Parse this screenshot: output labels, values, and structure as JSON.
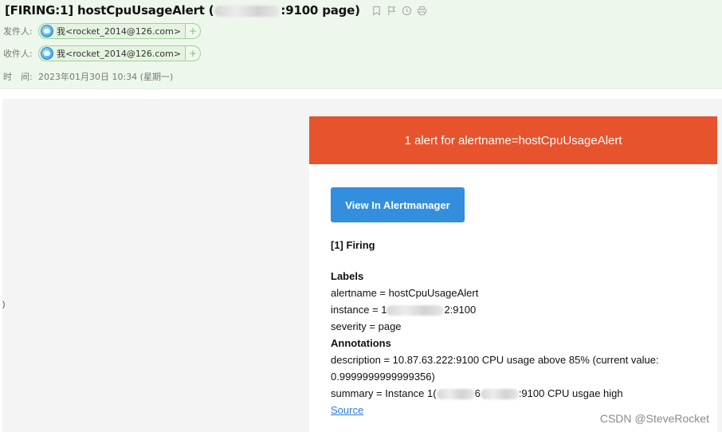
{
  "mail": {
    "subject_prefix": "[FIRING:1] hostCpuUsageAlert (",
    "subject_suffix": ":9100 page)",
    "action_icons": [
      "bookmark-icon",
      "flag-icon",
      "clock-icon",
      "print-icon"
    ],
    "from_label": "发件人:",
    "to_label": "收件人:",
    "time_label": "时　间:",
    "from_contact": "我<rocket_2014@126.com>",
    "to_contact": "我<rocket_2014@126.com>",
    "add_symbol": "+",
    "time_value": "2023年01月30日 10:34 (星期一)"
  },
  "body": {
    "side_mark": ")",
    "banner_text": "1 alert for alertname=hostCpuUsageAlert",
    "button_label": "View In Alertmanager",
    "firing_title": "[1] Firing",
    "labels_heading": "Labels",
    "label_alertname": "alertname = hostCpuUsageAlert",
    "label_instance_prefix": "instance = 1",
    "label_instance_suffix": "2:9100",
    "label_severity": "severity = page",
    "annotations_heading": "Annotations",
    "annotation_description_1": "description = 10.87.63.222:9100 CPU usage above 85% (current value:",
    "annotation_description_2": "0.9999999999999356)",
    "annotation_summary_prefix": "summary = Instance 1(",
    "annotation_summary_mid": "6",
    "annotation_summary_suffix": ":9100 CPU usgae high",
    "source_link": "Source"
  },
  "watermark": "CSDN @SteveRocket",
  "colors": {
    "header_bg": "#eef7ec",
    "banner": "#e6532d",
    "button": "#348ede",
    "link": "#2a7dd1"
  }
}
